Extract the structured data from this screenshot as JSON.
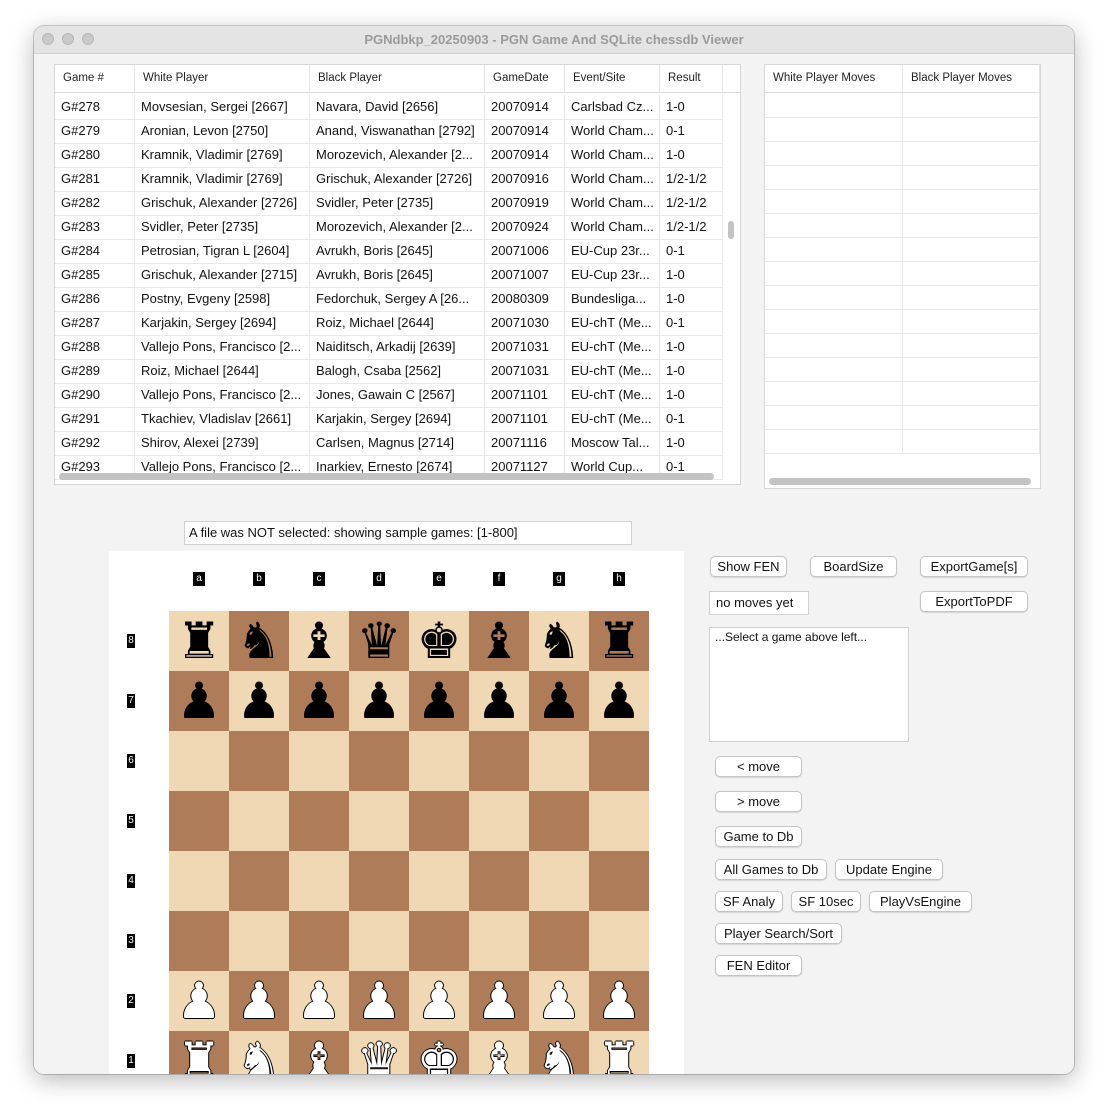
{
  "window": {
    "title": "PGNdbkp_20250903 - PGN Game And SQLite chessdb Viewer"
  },
  "games_table": {
    "columns": [
      "Game #",
      "White Player",
      "Black Player",
      "GameDate",
      "Event/Site",
      "Result"
    ],
    "rows": [
      [
        "G#278",
        "Movsesian, Sergei [2667]",
        "Navara, David [2656]",
        "20070914",
        "Carlsbad Cz...",
        "1-0"
      ],
      [
        "G#279",
        "Aronian, Levon [2750]",
        "Anand, Viswanathan [2792]",
        "20070914",
        "World Cham...",
        "0-1"
      ],
      [
        "G#280",
        "Kramnik, Vladimir [2769]",
        "Morozevich, Alexander [2...",
        "20070914",
        "World Cham...",
        "1-0"
      ],
      [
        "G#281",
        "Kramnik, Vladimir [2769]",
        "Grischuk, Alexander [2726]",
        "20070916",
        "World Cham...",
        "1/2-1/2"
      ],
      [
        "G#282",
        "Grischuk, Alexander [2726]",
        "Svidler, Peter [2735]",
        "20070919",
        "World Cham...",
        "1/2-1/2"
      ],
      [
        "G#283",
        "Svidler, Peter [2735]",
        "Morozevich, Alexander [2...",
        "20070924",
        "World Cham...",
        "1/2-1/2"
      ],
      [
        "G#284",
        "Petrosian, Tigran L [2604]",
        "Avrukh, Boris [2645]",
        "20071006",
        "EU-Cup 23r...",
        "0-1"
      ],
      [
        "G#285",
        "Grischuk, Alexander [2715]",
        "Avrukh, Boris [2645]",
        "20071007",
        "EU-Cup 23r...",
        "1-0"
      ],
      [
        "G#286",
        "Postny, Evgeny [2598]",
        "Fedorchuk, Sergey A [26...",
        "20080309",
        "Bundesliga...",
        "1-0"
      ],
      [
        "G#287",
        "Karjakin, Sergey [2694]",
        "Roiz, Michael [2644]",
        "20071030",
        "EU-chT (Me...",
        "0-1"
      ],
      [
        "G#288",
        "Vallejo Pons, Francisco [2...",
        "Naiditsch, Arkadij [2639]",
        "20071031",
        "EU-chT (Me...",
        "1-0"
      ],
      [
        "G#289",
        "Roiz, Michael [2644]",
        "Balogh, Csaba [2562]",
        "20071031",
        "EU-chT (Me...",
        "1-0"
      ],
      [
        "G#290",
        "Vallejo Pons, Francisco [2...",
        "Jones, Gawain C [2567]",
        "20071101",
        "EU-chT (Me...",
        "1-0"
      ],
      [
        "G#291",
        "Tkachiev, Vladislav [2661]",
        "Karjakin, Sergey [2694]",
        "20071101",
        "EU-chT (Me...",
        "0-1"
      ],
      [
        "G#292",
        "Shirov, Alexei [2739]",
        "Carlsen, Magnus [2714]",
        "20071116",
        "Moscow Tal...",
        "1-0"
      ],
      [
        "G#293",
        "Vallejo Pons, Francisco [2...",
        "Inarkiev, Ernesto [2674]",
        "20071127",
        "World Cup...",
        "0-1"
      ]
    ]
  },
  "moves_table": {
    "columns": [
      "White Player Moves",
      "Black Player Moves"
    ]
  },
  "file_status": "A file was NOT selected: showing sample games: [1-800]",
  "board": {
    "files": [
      "a",
      "b",
      "c",
      "d",
      "e",
      "f",
      "g",
      "h"
    ],
    "ranks": [
      "8",
      "7",
      "6",
      "5",
      "4",
      "3",
      "2",
      "1"
    ],
    "light_color": "#f0d8b4",
    "dark_color": "#ae7c59",
    "position": [
      [
        "br",
        "bn",
        "bb",
        "bq",
        "bk",
        "bb",
        "bn",
        "br"
      ],
      [
        "bp",
        "bp",
        "bp",
        "bp",
        "bp",
        "bp",
        "bp",
        "bp"
      ],
      [
        "",
        "",
        "",
        "",
        "",
        "",
        "",
        ""
      ],
      [
        "",
        "",
        "",
        "",
        "",
        "",
        "",
        ""
      ],
      [
        "",
        "",
        "",
        "",
        "",
        "",
        "",
        ""
      ],
      [
        "",
        "",
        "",
        "",
        "",
        "",
        "",
        ""
      ],
      [
        "wp",
        "wp",
        "wp",
        "wp",
        "wp",
        "wp",
        "wp",
        "wp"
      ],
      [
        "wr",
        "wn",
        "wb",
        "wq",
        "wk",
        "wb",
        "wn",
        "wr"
      ]
    ]
  },
  "buttons": {
    "show_fen": "Show FEN",
    "board_size": "BoardSize",
    "export_games": "ExportGame[s]",
    "export_pdf": "ExportToPDF",
    "prev_move": "< move",
    "next_move": "> move",
    "game_to_db": "Game to Db",
    "all_games_to_db": "All Games to Db",
    "update_engine": "Update Engine",
    "sf_analy": "SF Analy",
    "sf_10sec": "SF 10sec",
    "play_vs_engine": "PlayVsEngine",
    "player_search": "Player Search/Sort",
    "fen_editor": "FEN Editor"
  },
  "moves_field": "no moves yet",
  "notes_text": "...Select a game above left..."
}
